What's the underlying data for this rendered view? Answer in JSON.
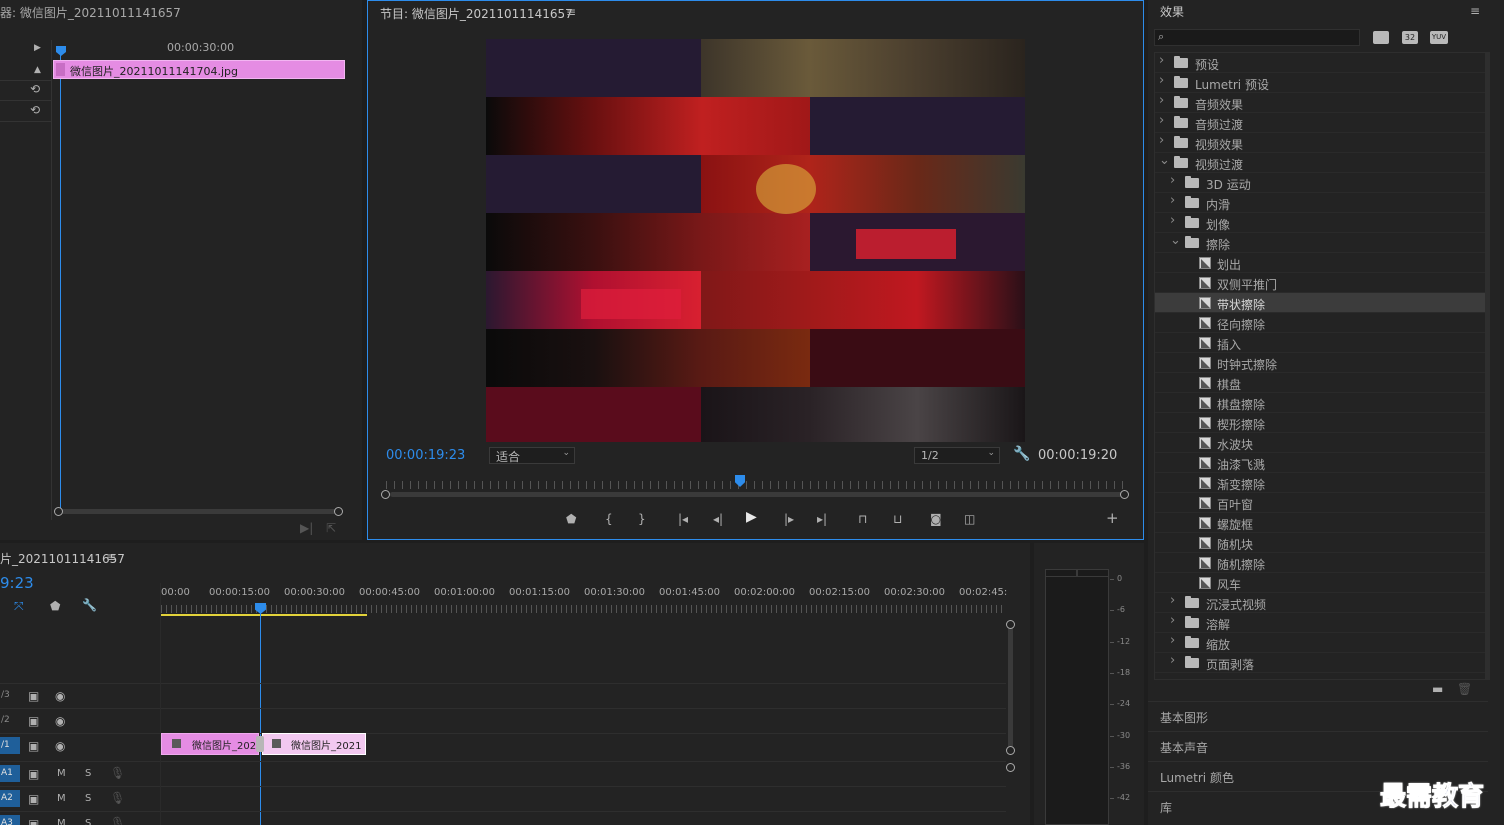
{
  "source_monitor": {
    "title": "器: 微信图片_20211011141657",
    "clip_left_label": "⁰",
    "ruler_time": "00:00:30:00",
    "clip_name": "微信图片_20211011141704.jpg"
  },
  "program_monitor": {
    "title": "节目: 微信图片_20211011141657",
    "timecode_current": "00:00:19:23",
    "fit_label": "适合",
    "resolution": "1/2",
    "timecode_duration": "00:00:19:20"
  },
  "timeline": {
    "title": "片_20211011141657",
    "timecode": "9:23",
    "ruler": [
      "00:00",
      "00:00:15:00",
      "00:00:30:00",
      "00:00:45:00",
      "00:01:00:00",
      "00:01:15:00",
      "00:01:30:00",
      "00:01:45:00",
      "00:02:00:00",
      "00:02:15:00",
      "00:02:30:00",
      "00:02:45:"
    ],
    "tracks": [
      {
        "name": "/3",
        "kind": "video"
      },
      {
        "name": "/2",
        "kind": "video"
      },
      {
        "name": "/1",
        "kind": "video"
      },
      {
        "name": "A1",
        "kind": "audio",
        "m": "M",
        "s": "S"
      },
      {
        "name": "A2",
        "kind": "audio",
        "m": "M",
        "s": "S"
      },
      {
        "name": "A3",
        "kind": "audio",
        "m": "M",
        "s": "S"
      }
    ],
    "clip1": "微信图片_202",
    "clip2": "微信图片_2021"
  },
  "meter": {
    "scale": [
      "0",
      "-6",
      "-12",
      "-18",
      "-24",
      "-30",
      "-36",
      "-42"
    ]
  },
  "effects": {
    "title": "效果",
    "search_placeholder": "",
    "badges": [
      "32",
      "YUV"
    ],
    "items": [
      {
        "label": "预设",
        "level": 0,
        "type": "preset",
        "open": false
      },
      {
        "label": "Lumetri 预设",
        "level": 0,
        "type": "preset",
        "open": false
      },
      {
        "label": "音频效果",
        "level": 0,
        "type": "folder",
        "open": false
      },
      {
        "label": "音频过渡",
        "level": 0,
        "type": "folder",
        "open": false
      },
      {
        "label": "视频效果",
        "level": 0,
        "type": "folder",
        "open": false
      },
      {
        "label": "视频过渡",
        "level": 0,
        "type": "folder",
        "open": true
      },
      {
        "label": "3D 运动",
        "level": 1,
        "type": "folder",
        "open": false
      },
      {
        "label": "内滑",
        "level": 1,
        "type": "folder",
        "open": false
      },
      {
        "label": "划像",
        "level": 1,
        "type": "folder",
        "open": false
      },
      {
        "label": "擦除",
        "level": 1,
        "type": "folder",
        "open": true
      },
      {
        "label": "划出",
        "level": 2,
        "type": "trans"
      },
      {
        "label": "双侧平推门",
        "level": 2,
        "type": "trans"
      },
      {
        "label": "带状擦除",
        "level": 2,
        "type": "trans",
        "selected": true
      },
      {
        "label": "径向擦除",
        "level": 2,
        "type": "trans"
      },
      {
        "label": "插入",
        "level": 2,
        "type": "trans"
      },
      {
        "label": "时钟式擦除",
        "level": 2,
        "type": "trans"
      },
      {
        "label": "棋盘",
        "level": 2,
        "type": "trans"
      },
      {
        "label": "棋盘擦除",
        "level": 2,
        "type": "trans"
      },
      {
        "label": "楔形擦除",
        "level": 2,
        "type": "trans"
      },
      {
        "label": "水波块",
        "level": 2,
        "type": "trans"
      },
      {
        "label": "油漆飞溅",
        "level": 2,
        "type": "trans"
      },
      {
        "label": "渐变擦除",
        "level": 2,
        "type": "trans"
      },
      {
        "label": "百叶窗",
        "level": 2,
        "type": "trans"
      },
      {
        "label": "螺旋框",
        "level": 2,
        "type": "trans"
      },
      {
        "label": "随机块",
        "level": 2,
        "type": "trans"
      },
      {
        "label": "随机擦除",
        "level": 2,
        "type": "trans"
      },
      {
        "label": "风车",
        "level": 2,
        "type": "trans"
      },
      {
        "label": "沉浸式视频",
        "level": 1,
        "type": "folder",
        "open": false
      },
      {
        "label": "溶解",
        "level": 1,
        "type": "folder",
        "open": false
      },
      {
        "label": "缩放",
        "level": 1,
        "type": "folder",
        "open": false
      },
      {
        "label": "页面剥落",
        "level": 1,
        "type": "folder",
        "open": false
      }
    ],
    "sections": [
      "基本图形",
      "基本声音",
      "Lumetri 颜色",
      "库"
    ]
  },
  "watermark": "最需教育",
  "colors": {
    "accent": "#2d8ceb",
    "clip_pink": "#e58ce3",
    "timecode": "#2d8ceb"
  }
}
